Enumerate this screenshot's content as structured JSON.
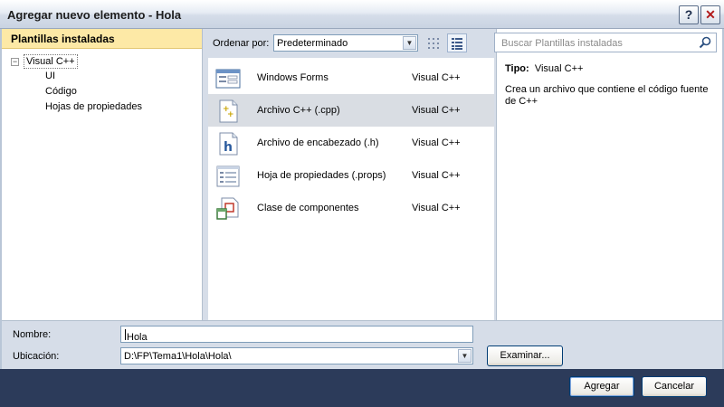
{
  "window": {
    "title": "Agregar nuevo elemento - Hola",
    "help_glyph": "?",
    "close_glyph": "✕"
  },
  "left_panel": {
    "header": "Plantillas instaladas",
    "tree": {
      "root_toggle": "−",
      "root": "Visual C++",
      "children": [
        "UI",
        "Código",
        "Hojas de propiedades"
      ]
    }
  },
  "toolbar": {
    "sort_label": "Ordenar por:",
    "sort_value": "Predeterminado",
    "view_small_icon": "small-icons-view-icon",
    "view_list_icon": "list-view-icon"
  },
  "templates": [
    {
      "icon": "windows-forms-icon",
      "name": "Windows Forms",
      "lang": "Visual C++",
      "selected": false
    },
    {
      "icon": "cpp-file-icon",
      "name": "Archivo C++ (.cpp)",
      "lang": "Visual C++",
      "selected": true
    },
    {
      "icon": "header-file-icon",
      "name": "Archivo de encabezado (.h)",
      "lang": "Visual C++",
      "selected": false
    },
    {
      "icon": "property-sheet-icon",
      "name": "Hoja de propiedades (.props)",
      "lang": "Visual C++",
      "selected": false
    },
    {
      "icon": "component-class-icon",
      "name": "Clase de componentes",
      "lang": "Visual C++",
      "selected": false
    }
  ],
  "search": {
    "placeholder": "Buscar Plantillas instaladas"
  },
  "details": {
    "type_label": "Tipo:",
    "type_value": "Visual C++",
    "description": "Crea un archivo que contiene el código fuente de C++"
  },
  "form": {
    "name_label": "Nombre:",
    "name_value": "Hola",
    "location_label": "Ubicación:",
    "location_value": "D:\\FP\\Tema1\\Hola\\Hola\\",
    "browse_label": "Examinar..."
  },
  "actions": {
    "add_label": "Agregar",
    "cancel_label": "Cancelar"
  },
  "colors": {
    "header_highlight": "#fde9a6",
    "footer_bar": "#2c3b5a",
    "selected_row": "#d9dde3"
  }
}
